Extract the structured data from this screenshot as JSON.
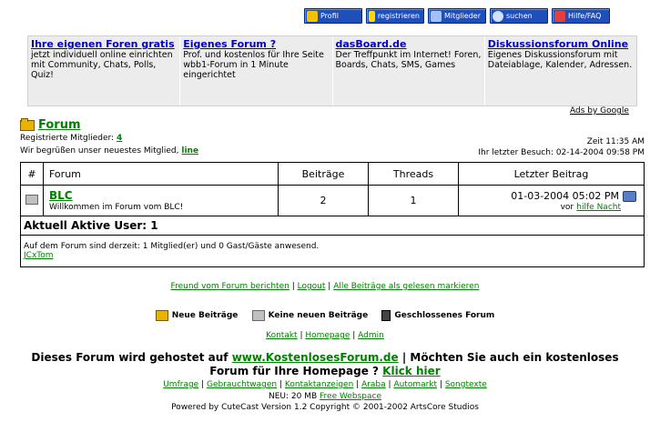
{
  "nav": [
    {
      "label": "Profil",
      "icon": "profile-icon"
    },
    {
      "label": "registrieren",
      "icon": "key-icon"
    },
    {
      "label": "Mitglieder",
      "icon": "members-icon"
    },
    {
      "label": "suchen",
      "icon": "search-icon"
    },
    {
      "label": "Hilfe/FAQ",
      "icon": "help-icon"
    }
  ],
  "ads": [
    {
      "title": "Ihre eigenen Foren gratis",
      "text": "jetzt individuell online einrichten mit Community, Chats, Polls, Quiz!"
    },
    {
      "title": "Eigenes Forum ?",
      "text": "Prof. und kostenlos für Ihre Seite wbb1-Forum in 1 Minute eingerichtet"
    },
    {
      "title": "dasBoard.de",
      "text": "Der Treffpunkt im Internet! Foren, Boards, Chats, SMS, Games"
    },
    {
      "title": "Diskussionsforum Online",
      "text": "Eigenes Diskussionsforum mit Dateiablage, Kalender, Adressen."
    }
  ],
  "ads_by": "Ads by Google",
  "forum_title": "Forum",
  "registered_label": "Registrierte Mitglieder:",
  "registered_count": "4",
  "welcome_text": "Wir begrüßen unser neuestes Mitglied,",
  "newest_member": "line",
  "time_text": "Zeit 11:35 AM",
  "last_visit": "Ihr letzter Besuch: 02-14-2004 09:58 PM",
  "table": {
    "headers": [
      "#",
      "Forum",
      "Beiträge",
      "Threads",
      "Letzter Beitrag"
    ],
    "row": {
      "name": "BLC",
      "desc": "Willkommen im Forum vom BLC!",
      "posts": "2",
      "threads": "1",
      "last_date": "01-03-2004 05:02 PM",
      "last_by": "vor",
      "last_user": "hilfe Nacht"
    },
    "active_title": "Aktuell Aktive User: 1",
    "active_text": "Auf dem Forum sind derzeit: 1 Mitglied(er) und 0 Gast/Gäste anwesend.",
    "active_user": "JCxTom"
  },
  "links": [
    "Freund vom Forum berichten",
    "Logout",
    "Alle Beiträge als gelesen markieren"
  ],
  "legend": [
    "Neue Beiträge",
    "Keine neuen Beiträge",
    "Geschlossenes Forum"
  ],
  "footer_links": [
    "Kontakt",
    "Homepage",
    "Admin"
  ],
  "hosted_pre": "Dieses Forum wird gehostet auf",
  "hosted_link": "www.KostenlosesForum.de",
  "hosted_post": "| Möchten Sie auch ein kostenloses",
  "hosted_line2": "Forum für Ihre Homepage ?",
  "hosted_click": "Klick hier",
  "bottom_links": [
    "Umfrage",
    "Gebrauchtwagen",
    "Kontaktanzeigen",
    "Araba",
    "Automarkt",
    "Songtexte"
  ],
  "new_text": "NEU: 20 MB",
  "new_link": "Free Webspace",
  "powered": "Powered by CuteCast Version 1.2 Copyright © 2001-2002 ArtsCore Studios",
  "colors": {
    "link": "#008000",
    "nav_bg": "#1f4fb8",
    "ad_bg": "#ececec"
  }
}
